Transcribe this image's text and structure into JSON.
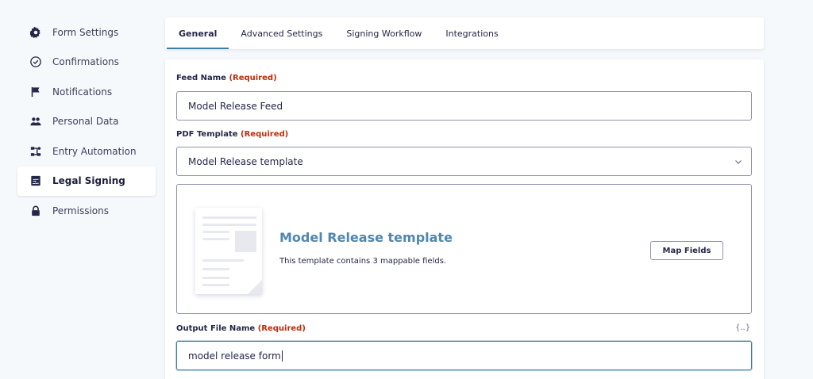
{
  "sidebar": {
    "items": [
      {
        "label": "Form Settings",
        "icon": "gear-icon"
      },
      {
        "label": "Confirmations",
        "icon": "check-circle-icon"
      },
      {
        "label": "Notifications",
        "icon": "flag-icon"
      },
      {
        "label": "Personal Data",
        "icon": "users-icon"
      },
      {
        "label": "Entry Automation",
        "icon": "workflow-icon"
      },
      {
        "label": "Legal Signing",
        "icon": "signature-document-icon",
        "active": true
      },
      {
        "label": "Permissions",
        "icon": "lock-icon"
      }
    ]
  },
  "tabs": [
    {
      "label": "General",
      "active": true
    },
    {
      "label": "Advanced Settings"
    },
    {
      "label": "Signing Workflow"
    },
    {
      "label": "Integrations"
    }
  ],
  "form": {
    "feed_name": {
      "label": "Feed Name",
      "required": "(Required)",
      "value": "Model Release Feed"
    },
    "pdf_template": {
      "label": "PDF Template",
      "required": "(Required)",
      "value": "Model Release template"
    },
    "template_preview": {
      "title": "Model Release template",
      "description": "This template contains 3 mappable fields.",
      "map_button": "Map Fields"
    },
    "output_file": {
      "label": "Output File Name",
      "required": "(Required)",
      "value": "model release form",
      "merge_tag": "{..}"
    }
  },
  "colors": {
    "accent": "#3e7da6",
    "required": "#c02b0a",
    "template_title": "#4f87b0",
    "background": "#f6f9fc"
  }
}
